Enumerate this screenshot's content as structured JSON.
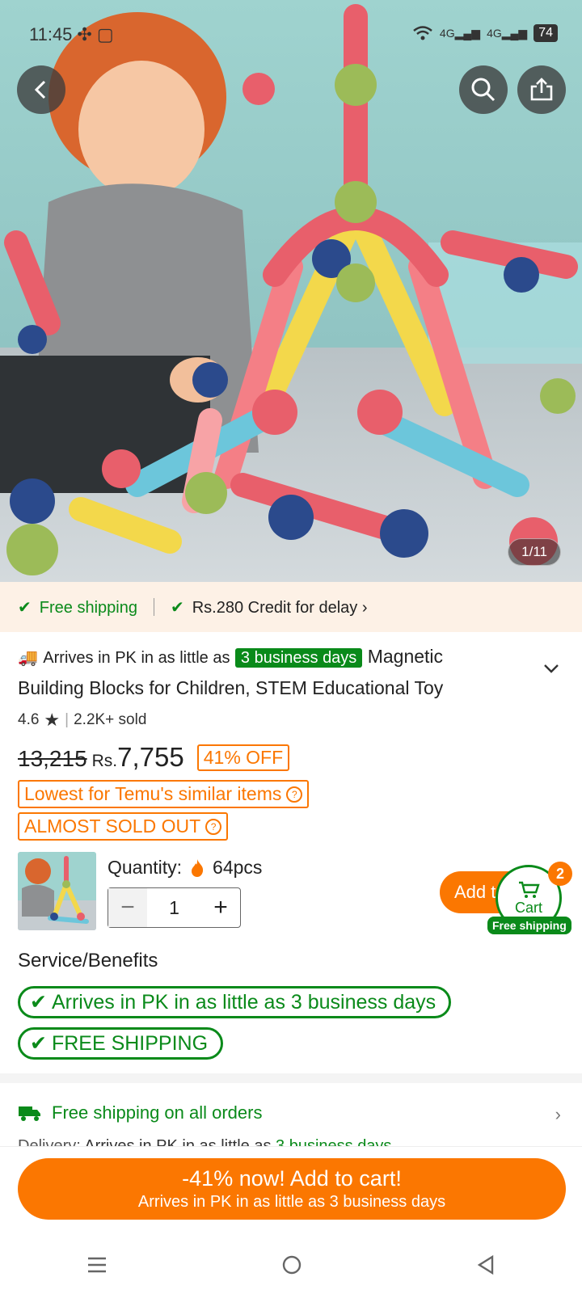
{
  "status_bar": {
    "time": "11:45",
    "battery": "74"
  },
  "image_counter": "1/11",
  "shipping_strip": {
    "free_shipping": "Free shipping",
    "credit": "Rs.280 Credit for delay"
  },
  "title": {
    "arrives_prefix": "Arrives in PK in as little as",
    "business_days_badge": "3 business days",
    "product_name_1": "Magnetic",
    "product_name_2": "Building Blocks for Children, STEM Educational Toy"
  },
  "rating": {
    "score": "4.6",
    "sold": "2.2K+ sold"
  },
  "price": {
    "original": "13,215",
    "currency": "Rs.",
    "current": "7,755",
    "discount": "41% OFF"
  },
  "tags": {
    "lowest": "Lowest for Temu's similar items",
    "almost_sold_out": "ALMOST SOLD OUT"
  },
  "quantity": {
    "label": "Quantity:",
    "stock": "64pcs",
    "value": "1"
  },
  "add_button": "Add t",
  "cart": {
    "label": "Cart",
    "count": "2",
    "free_shipping": "Free shipping"
  },
  "service": {
    "title": "Service/Benefits",
    "benefit_1": "Arrives in PK in as little as 3 business days",
    "benefit_2": "FREE SHIPPING"
  },
  "delivery": {
    "free_all": "Free shipping on all orders",
    "label": "Delivery:",
    "text": "Arrives in PK in as little as",
    "days": "3 business days"
  },
  "cta": {
    "main": "-41% now! Add to cart!",
    "sub": "Arrives in PK in as little as 3 business days"
  },
  "colors": {
    "accent": "#fb7701",
    "green": "#0a8a1a",
    "strip_bg": "#fdf1e6"
  }
}
